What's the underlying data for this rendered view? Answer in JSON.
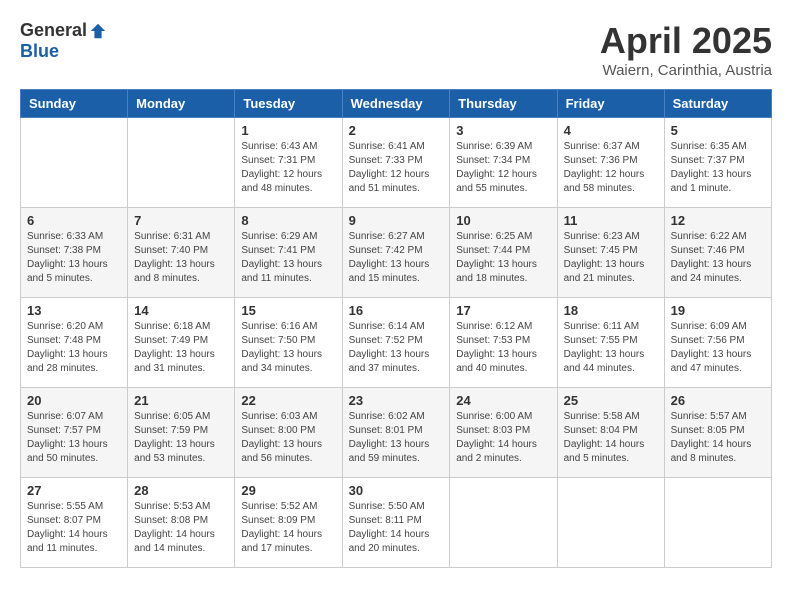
{
  "header": {
    "logo_general": "General",
    "logo_blue": "Blue",
    "month_title": "April 2025",
    "location": "Waiern, Carinthia, Austria"
  },
  "weekdays": [
    "Sunday",
    "Monday",
    "Tuesday",
    "Wednesday",
    "Thursday",
    "Friday",
    "Saturday"
  ],
  "weeks": [
    [
      null,
      null,
      {
        "day": 1,
        "sunrise": "6:43 AM",
        "sunset": "7:31 PM",
        "daylight": "12 hours and 48 minutes."
      },
      {
        "day": 2,
        "sunrise": "6:41 AM",
        "sunset": "7:33 PM",
        "daylight": "12 hours and 51 minutes."
      },
      {
        "day": 3,
        "sunrise": "6:39 AM",
        "sunset": "7:34 PM",
        "daylight": "12 hours and 55 minutes."
      },
      {
        "day": 4,
        "sunrise": "6:37 AM",
        "sunset": "7:36 PM",
        "daylight": "12 hours and 58 minutes."
      },
      {
        "day": 5,
        "sunrise": "6:35 AM",
        "sunset": "7:37 PM",
        "daylight": "13 hours and 1 minute."
      }
    ],
    [
      {
        "day": 6,
        "sunrise": "6:33 AM",
        "sunset": "7:38 PM",
        "daylight": "13 hours and 5 minutes."
      },
      {
        "day": 7,
        "sunrise": "6:31 AM",
        "sunset": "7:40 PM",
        "daylight": "13 hours and 8 minutes."
      },
      {
        "day": 8,
        "sunrise": "6:29 AM",
        "sunset": "7:41 PM",
        "daylight": "13 hours and 11 minutes."
      },
      {
        "day": 9,
        "sunrise": "6:27 AM",
        "sunset": "7:42 PM",
        "daylight": "13 hours and 15 minutes."
      },
      {
        "day": 10,
        "sunrise": "6:25 AM",
        "sunset": "7:44 PM",
        "daylight": "13 hours and 18 minutes."
      },
      {
        "day": 11,
        "sunrise": "6:23 AM",
        "sunset": "7:45 PM",
        "daylight": "13 hours and 21 minutes."
      },
      {
        "day": 12,
        "sunrise": "6:22 AM",
        "sunset": "7:46 PM",
        "daylight": "13 hours and 24 minutes."
      }
    ],
    [
      {
        "day": 13,
        "sunrise": "6:20 AM",
        "sunset": "7:48 PM",
        "daylight": "13 hours and 28 minutes."
      },
      {
        "day": 14,
        "sunrise": "6:18 AM",
        "sunset": "7:49 PM",
        "daylight": "13 hours and 31 minutes."
      },
      {
        "day": 15,
        "sunrise": "6:16 AM",
        "sunset": "7:50 PM",
        "daylight": "13 hours and 34 minutes."
      },
      {
        "day": 16,
        "sunrise": "6:14 AM",
        "sunset": "7:52 PM",
        "daylight": "13 hours and 37 minutes."
      },
      {
        "day": 17,
        "sunrise": "6:12 AM",
        "sunset": "7:53 PM",
        "daylight": "13 hours and 40 minutes."
      },
      {
        "day": 18,
        "sunrise": "6:11 AM",
        "sunset": "7:55 PM",
        "daylight": "13 hours and 44 minutes."
      },
      {
        "day": 19,
        "sunrise": "6:09 AM",
        "sunset": "7:56 PM",
        "daylight": "13 hours and 47 minutes."
      }
    ],
    [
      {
        "day": 20,
        "sunrise": "6:07 AM",
        "sunset": "7:57 PM",
        "daylight": "13 hours and 50 minutes."
      },
      {
        "day": 21,
        "sunrise": "6:05 AM",
        "sunset": "7:59 PM",
        "daylight": "13 hours and 53 minutes."
      },
      {
        "day": 22,
        "sunrise": "6:03 AM",
        "sunset": "8:00 PM",
        "daylight": "13 hours and 56 minutes."
      },
      {
        "day": 23,
        "sunrise": "6:02 AM",
        "sunset": "8:01 PM",
        "daylight": "13 hours and 59 minutes."
      },
      {
        "day": 24,
        "sunrise": "6:00 AM",
        "sunset": "8:03 PM",
        "daylight": "14 hours and 2 minutes."
      },
      {
        "day": 25,
        "sunrise": "5:58 AM",
        "sunset": "8:04 PM",
        "daylight": "14 hours and 5 minutes."
      },
      {
        "day": 26,
        "sunrise": "5:57 AM",
        "sunset": "8:05 PM",
        "daylight": "14 hours and 8 minutes."
      }
    ],
    [
      {
        "day": 27,
        "sunrise": "5:55 AM",
        "sunset": "8:07 PM",
        "daylight": "14 hours and 11 minutes."
      },
      {
        "day": 28,
        "sunrise": "5:53 AM",
        "sunset": "8:08 PM",
        "daylight": "14 hours and 14 minutes."
      },
      {
        "day": 29,
        "sunrise": "5:52 AM",
        "sunset": "8:09 PM",
        "daylight": "14 hours and 17 minutes."
      },
      {
        "day": 30,
        "sunrise": "5:50 AM",
        "sunset": "8:11 PM",
        "daylight": "14 hours and 20 minutes."
      },
      null,
      null,
      null
    ]
  ]
}
